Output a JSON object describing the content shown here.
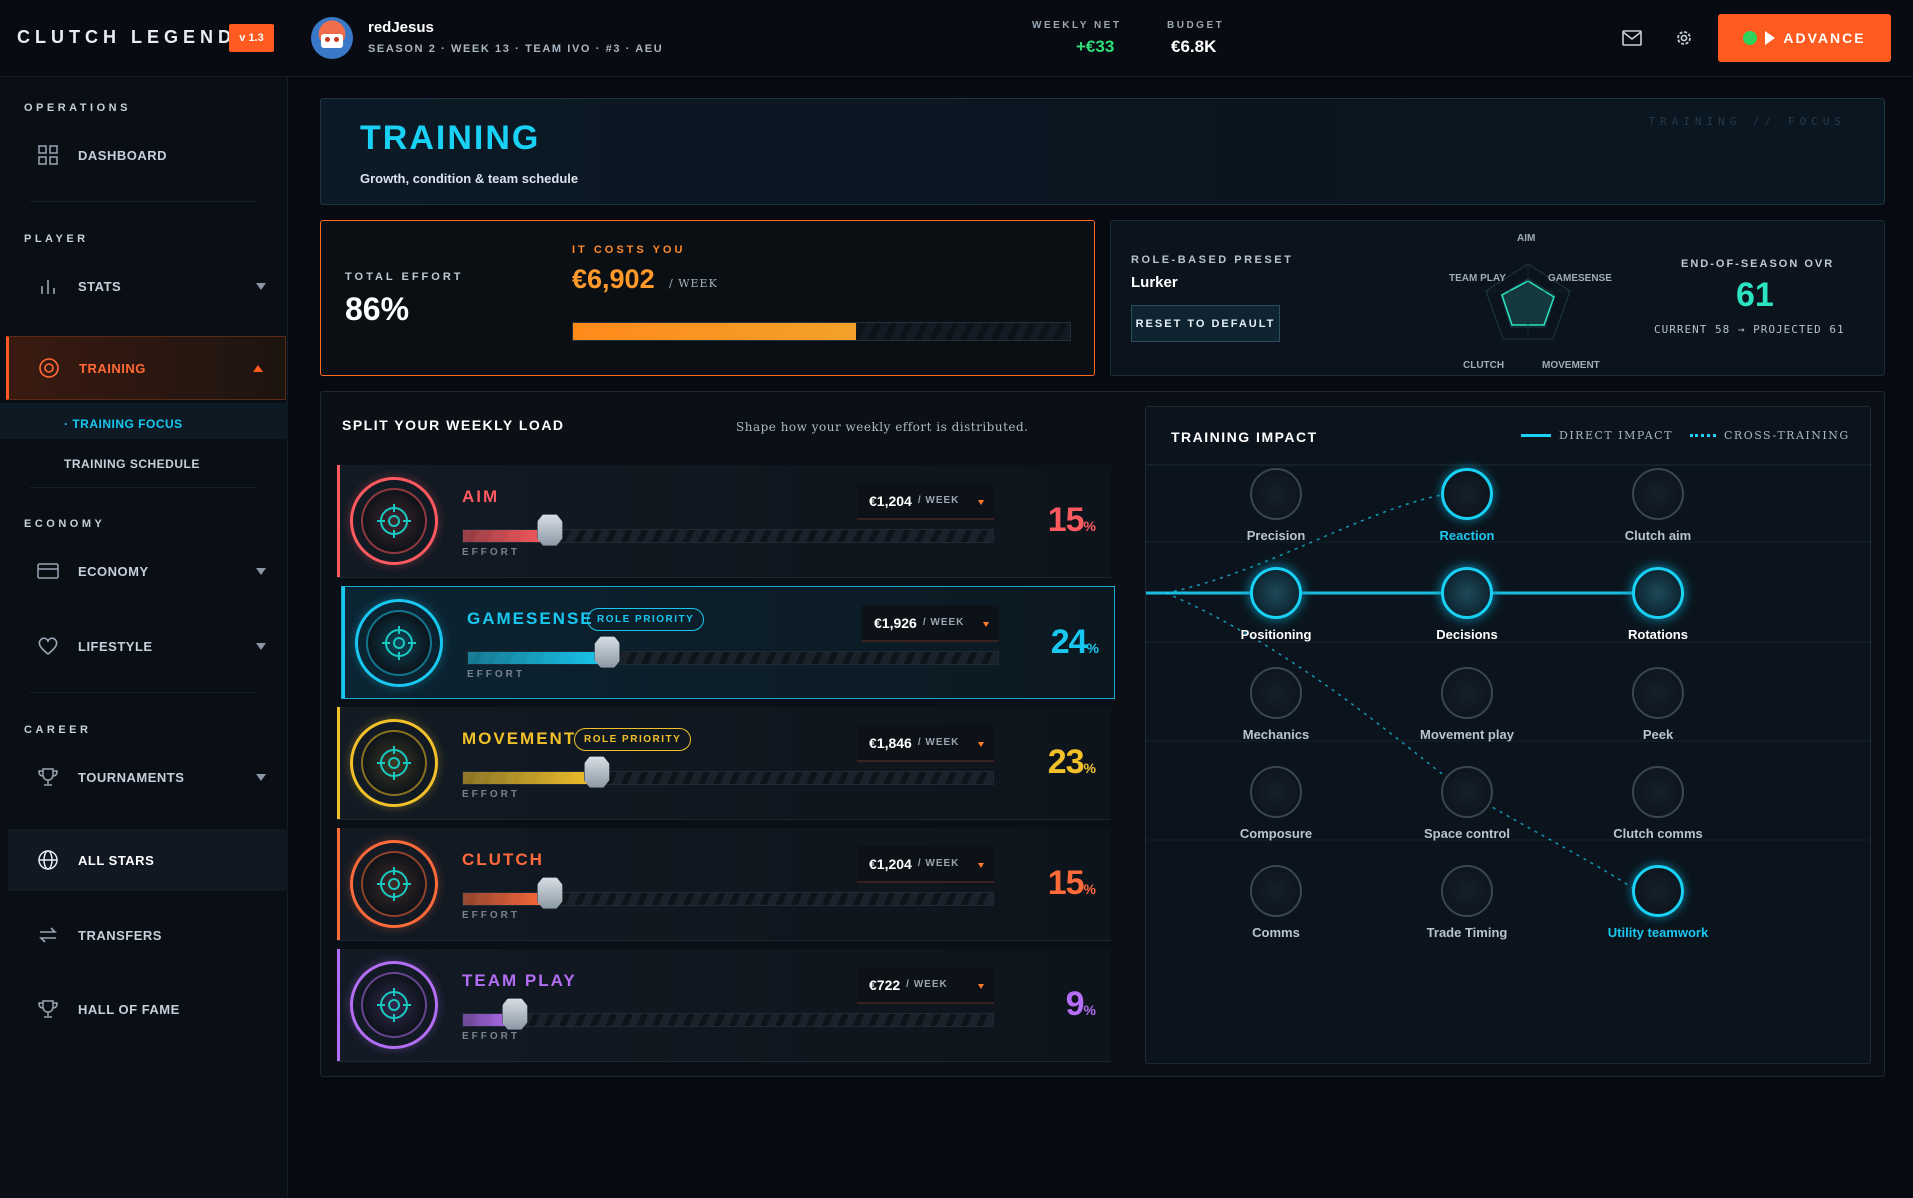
{
  "app": {
    "title": "CLUTCH LEGEND",
    "version": "v 1.3"
  },
  "user": {
    "name": "redJesus",
    "season_line": "SEASON 2 · WEEK 13 · TEAM IVO · #3 · AEU"
  },
  "stats": {
    "weekly_net_label": "WEEKLY NET",
    "weekly_net": "+€33",
    "budget_label": "BUDGET",
    "budget": "€6.8K"
  },
  "advance_label": "ADVANCE",
  "sidebar": {
    "sections": {
      "operations": "OPERATIONS",
      "player": "PLAYER",
      "economy": "ECONOMY",
      "career": "CAREER"
    },
    "items": {
      "dashboard": "DASHBOARD",
      "stats": "STATS",
      "training": "TRAINING",
      "training_focus": "· TRAINING FOCUS",
      "training_schedule": "TRAINING SCHEDULE",
      "economy": "ECONOMY",
      "lifestyle": "LIFESTYLE",
      "tournaments": "TOURNAMENTS",
      "all_stars": "ALL STARS",
      "transfers": "TRANSFERS",
      "hall_of_fame": "HALL OF FAME"
    }
  },
  "header": {
    "title": "TRAINING",
    "subtitle": "Growth, condition & team schedule",
    "crumb": "TRAINING // FOCUS"
  },
  "effort": {
    "label": "TOTAL EFFORT",
    "value": "86%",
    "cost_label": "IT COSTS YOU",
    "cost_value": "€6,902",
    "cost_unit": "/ WEEK",
    "bar_fraction": 0.57
  },
  "preset": {
    "label": "ROLE-BASED PRESET",
    "value": "Lurker",
    "reset_label": "RESET TO DEFAULT",
    "radar_labels": {
      "aim": "AIM",
      "gamesense": "GAMESENSE",
      "movement": "MOVEMENT",
      "clutch": "CLUTCH",
      "teamplay": "TEAM PLAY"
    },
    "ovr_label": "END-OF-SEASON OVR",
    "ovr_value": "61",
    "ovr_sub": "CURRENT 58 → PROJECTED 61"
  },
  "split": {
    "title": "SPLIT YOUR WEEKLY LOAD",
    "description": "Shape how your weekly effort is distributed.",
    "effort_tag": "EFFORT",
    "week_unit": "/ WEEK",
    "skills": [
      {
        "name": "AIM",
        "cost": "€1,204",
        "pct": "15",
        "pct_sign": "%",
        "fill": 0.15,
        "color": "#ff5a5f",
        "badge": ""
      },
      {
        "name": "GAMESENSE",
        "cost": "€1,926",
        "pct": "24",
        "pct_sign": "%",
        "fill": 0.24,
        "color": "#19c8f0",
        "badge": "ROLE PRIORITY"
      },
      {
        "name": "MOVEMENT",
        "cost": "€1,846",
        "pct": "23",
        "pct_sign": "%",
        "fill": 0.23,
        "color": "#f2c12a",
        "badge": "ROLE PRIORITY"
      },
      {
        "name": "CLUTCH",
        "cost": "€1,204",
        "pct": "15",
        "pct_sign": "%",
        "fill": 0.15,
        "color": "#ff6a3a",
        "badge": ""
      },
      {
        "name": "TEAM PLAY",
        "cost": "€722",
        "pct": "9",
        "pct_sign": "%",
        "fill": 0.09,
        "color": "#b46ef5",
        "badge": ""
      }
    ]
  },
  "impact": {
    "title": "TRAINING IMPACT",
    "legend_direct": "DIRECT IMPACT",
    "legend_cross": "CROSS-TRAINING",
    "nodes": [
      [
        "Precision",
        "Reaction",
        "Clutch aim"
      ],
      [
        "Positioning",
        "Decisions",
        "Rotations"
      ],
      [
        "Mechanics",
        "Movement play",
        "Peek"
      ],
      [
        "Composure",
        "Space control",
        "Clutch comms"
      ],
      [
        "Comms",
        "Trade Timing",
        "Utility teamwork"
      ]
    ]
  },
  "colors": {
    "accent": "#ff5a1f",
    "cyan": "#19d0f5",
    "teal": "#2be3c0"
  }
}
